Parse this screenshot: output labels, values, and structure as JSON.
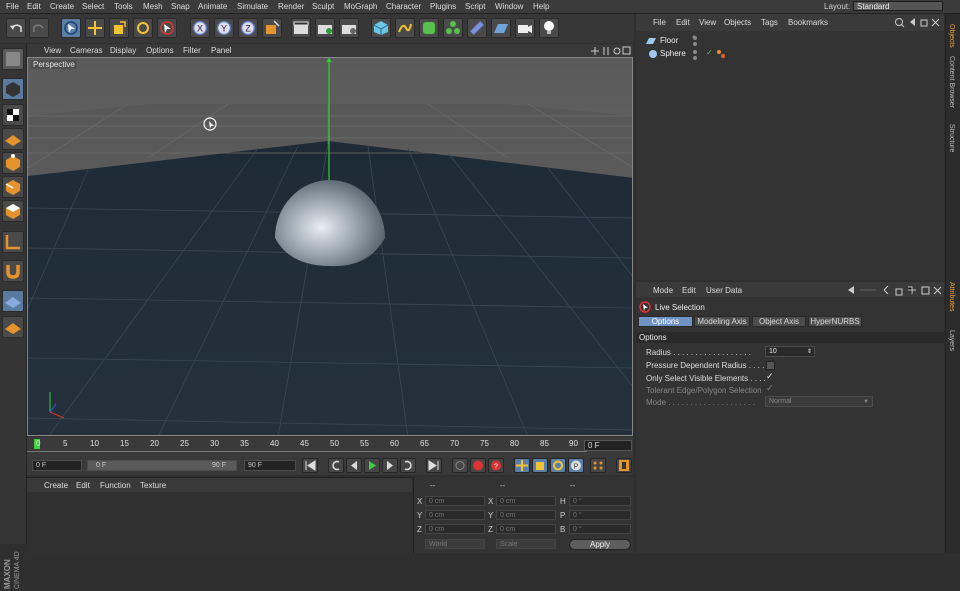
{
  "menubar": {
    "items": [
      "File",
      "Edit",
      "Create",
      "Select",
      "Tools",
      "Mesh",
      "Snap",
      "Animate",
      "Simulate",
      "Render",
      "Sculpt",
      "MoGraph",
      "Character",
      "Plugins",
      "Script",
      "Window",
      "Help"
    ],
    "layout_label": "Layout:",
    "layout_value": "Standard"
  },
  "viewport": {
    "menu": [
      "View",
      "Cameras",
      "Display",
      "Options",
      "Filter",
      "Panel"
    ],
    "label": "Perspective"
  },
  "timeline": {
    "ticks": [
      "0",
      "5",
      "10",
      "15",
      "20",
      "25",
      "30",
      "35",
      "40",
      "45",
      "50",
      "55",
      "60",
      "65",
      "70",
      "75",
      "80",
      "85",
      "90"
    ],
    "current_frame": "0 F"
  },
  "transport": {
    "start": "0 F",
    "range_start": "0 F",
    "range_end": "90 F",
    "end": "90 F"
  },
  "material_manager": {
    "menu": [
      "Create",
      "Edit",
      "Function",
      "Texture"
    ]
  },
  "coordinates": {
    "headers": [
      "--",
      "--",
      "--"
    ],
    "rows": [
      {
        "a": "X",
        "av": "0 cm",
        "b": "X",
        "bv": "0 cm",
        "c": "H",
        "cv": "0 °"
      },
      {
        "a": "Y",
        "av": "0 cm",
        "b": "Y",
        "bv": "0 cm",
        "c": "P",
        "cv": "0 °"
      },
      {
        "a": "Z",
        "av": "0 cm",
        "b": "Z",
        "bv": "0 cm",
        "c": "B",
        "cv": "0 °"
      }
    ],
    "mode1": "World",
    "mode2": "Scale",
    "apply": "Apply"
  },
  "object_manager": {
    "menu": [
      "File",
      "Edit",
      "View",
      "Objects",
      "Tags",
      "Bookmarks"
    ],
    "objects": [
      "Floor",
      "Sphere"
    ]
  },
  "attributes": {
    "menu": [
      "Mode",
      "Edit",
      "User Data"
    ],
    "tool_name": "Live Selection",
    "tabs": [
      "Options",
      "Modeling Axis",
      "Object Axis",
      "HyperNURBS"
    ],
    "section": "Options",
    "radius_label": "Radius . . . . . . . . . . . . . . . . . .",
    "radius_value": "10",
    "pressure_label": "Pressure Dependent Radius . . . .",
    "visible_label": "Only Select Visible Elements . . . .",
    "tolerant_label": "Tolerant Edge/Polygon Selection",
    "mode_label": "Mode . . . . . . . . . . . . . . . . . . . .",
    "mode_value": "Normal"
  },
  "side_tabs": [
    "Objects",
    "Content Browser",
    "Structure",
    "Attributes",
    "Layers"
  ],
  "branding": {
    "line1": "MAXON",
    "line2": "CINEMA 4D"
  },
  "colors": {
    "accent": "#6f93c4",
    "active_tab": "#e8a23a"
  }
}
